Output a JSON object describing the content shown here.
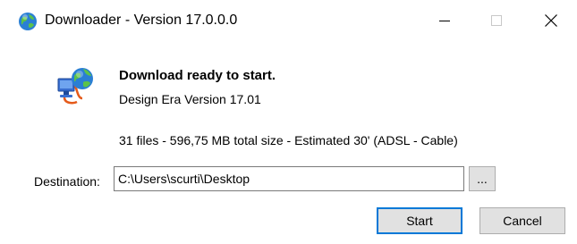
{
  "window": {
    "title": "Downloader - Version 17.0.0.0",
    "controls": {
      "minimize_icon": "minimize-icon",
      "maximize_icon": "maximize-icon",
      "close_icon": "close-icon"
    }
  },
  "main": {
    "heading": "Download ready to start.",
    "subtitle": "Design Era Version 17.01",
    "summary": "31 files - 596,75 MB total size - Estimated 30' (ADSL - Cable)"
  },
  "destination": {
    "label": "Destination:",
    "value": "C:\\Users\\scurti\\Desktop",
    "browse_label": "..."
  },
  "buttons": {
    "start_label": "Start",
    "cancel_label": "Cancel"
  },
  "colors": {
    "accent": "#0078d7",
    "button_face": "#e1e1e1",
    "button_border": "#adadad"
  }
}
